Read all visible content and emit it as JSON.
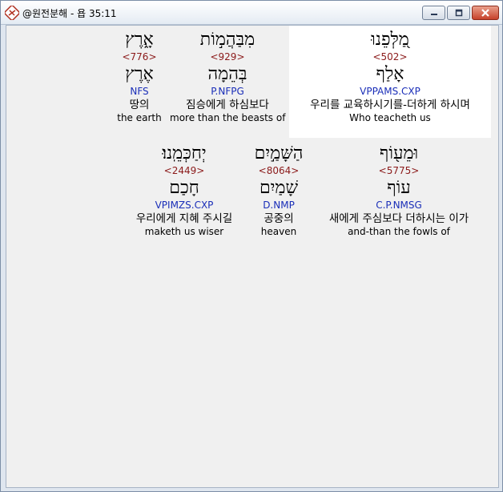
{
  "window": {
    "title": "@원전분해 - 욥 35:11",
    "minimize_label": "minimize",
    "maximize_label": "maximize",
    "close_label": "close"
  },
  "colors": {
    "strong_number": "#8b1a1a",
    "morphology": "#1a2eb8",
    "highlight": "#ffffff",
    "background": "#f0f0f0"
  },
  "rows": [
    {
      "words": [
        {
          "hebrew": "אָ֑רֶץ",
          "strong": "<776>",
          "lemma": "אֶרֶץ",
          "morph": "NFS",
          "korean": "땅의",
          "english": "the earth"
        },
        {
          "hebrew": "מִבַּהֲמ֣וֹת",
          "strong": "<929>",
          "lemma": "בְּהֵמָה",
          "morph": "P.NFPG",
          "korean": "짐승에게 하심보다",
          "english": "more than the beasts of"
        },
        {
          "hebrew": "מַ֭לְּפֵנוּ",
          "strong": "<502>",
          "lemma": "אָלַף",
          "morph": "VPPAMS.CXP",
          "korean": "우리를 교육하시기를-더하게 하시며",
          "english": "Who teacheth us",
          "highlighted": true
        }
      ]
    },
    {
      "words": [
        {
          "hebrew": "יְחַכְּמֵֽנוּ׃",
          "strong": "<2449>",
          "lemma": "חָכַם",
          "morph": "VPIMZS.CXP",
          "korean": "우리에게 지혜 주시길",
          "english": "maketh us wiser"
        },
        {
          "hebrew": "הַשָּׁמַ֣יִם",
          "strong": "<8064>",
          "lemma": "שָׁמַיִם",
          "morph": "D.NMP",
          "korean": "공중의",
          "english": "heaven"
        },
        {
          "hebrew": "וּמֵע֖וֹף",
          "strong": "<5775>",
          "lemma": "עוֹף",
          "morph": "C.P.NMSG",
          "korean": "새에게 주심보다 더하시는 이가",
          "english": "and-than the fowls of"
        }
      ]
    }
  ]
}
